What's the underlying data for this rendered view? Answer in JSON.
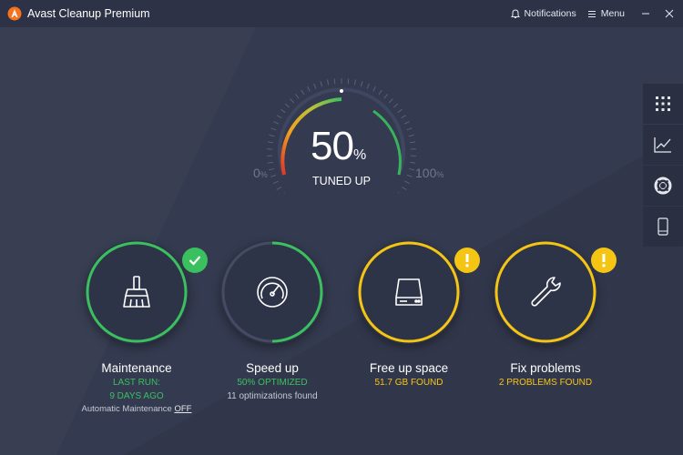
{
  "app": {
    "title": "Avast Cleanup Premium"
  },
  "titlebar": {
    "notifications": "Notifications",
    "menu": "Menu"
  },
  "gauge": {
    "value": "50",
    "unit": "%",
    "label": "TUNED UP",
    "min": "0",
    "max": "100",
    "min_unit": "%",
    "max_unit": "%",
    "level": 0.5
  },
  "side_panel": [
    "grid-icon",
    "chart-icon",
    "lifebuoy-icon",
    "phone-icon"
  ],
  "tiles": [
    {
      "title": "Maintenance",
      "line1": "LAST RUN:",
      "line2": "9 DAYS AGO",
      "line3_prefix": "Automatic Maintenance",
      "line3_link": "OFF",
      "status": "ok",
      "color": "#3ac05e"
    },
    {
      "title": "Speed up",
      "line1": "50% OPTIMIZED",
      "line2": "11 optimizations found",
      "progress": 0.5,
      "color": "#3ac05e"
    },
    {
      "title": "Free up space",
      "line1": "51.7 GB FOUND",
      "status": "warn",
      "color": "#f5c514"
    },
    {
      "title": "Fix problems",
      "line1": "2 PROBLEMS FOUND",
      "status": "warn",
      "color": "#f5c514"
    }
  ],
  "colors": {
    "background": "#343a4f",
    "green": "#3ac05e",
    "yellow": "#f5c514",
    "orange": "#f5731e"
  }
}
